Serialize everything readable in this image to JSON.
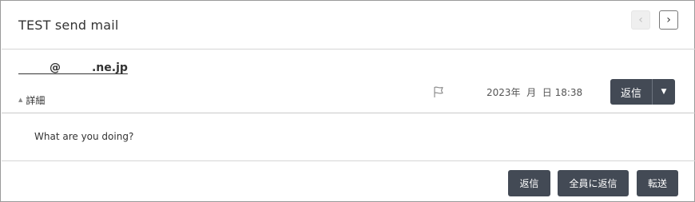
{
  "mail": {
    "subject": "TEST send mail",
    "sender": "        @        .ne.jp",
    "details_label": "詳細",
    "details_toggle_glyph": "▲",
    "date": "2023年  月  日 18:38",
    "body": "What are you doing?"
  },
  "nav": {
    "prev_glyph": "‹",
    "next_glyph": "›"
  },
  "actions": {
    "reply_label": "返信",
    "reply_dropdown_glyph": "▼",
    "footer_reply_label": "返信",
    "footer_reply_all_label": "全員に返信",
    "footer_forward_label": "転送"
  },
  "icons": {
    "flag": "flag-icon",
    "prev": "chevron-left-icon",
    "next": "chevron-right-icon",
    "dropdown": "caret-down-icon",
    "details_toggle": "caret-up-icon"
  },
  "colors": {
    "button_bg": "#434a55",
    "button_text": "#ffffff",
    "border": "#9a9a9a"
  }
}
